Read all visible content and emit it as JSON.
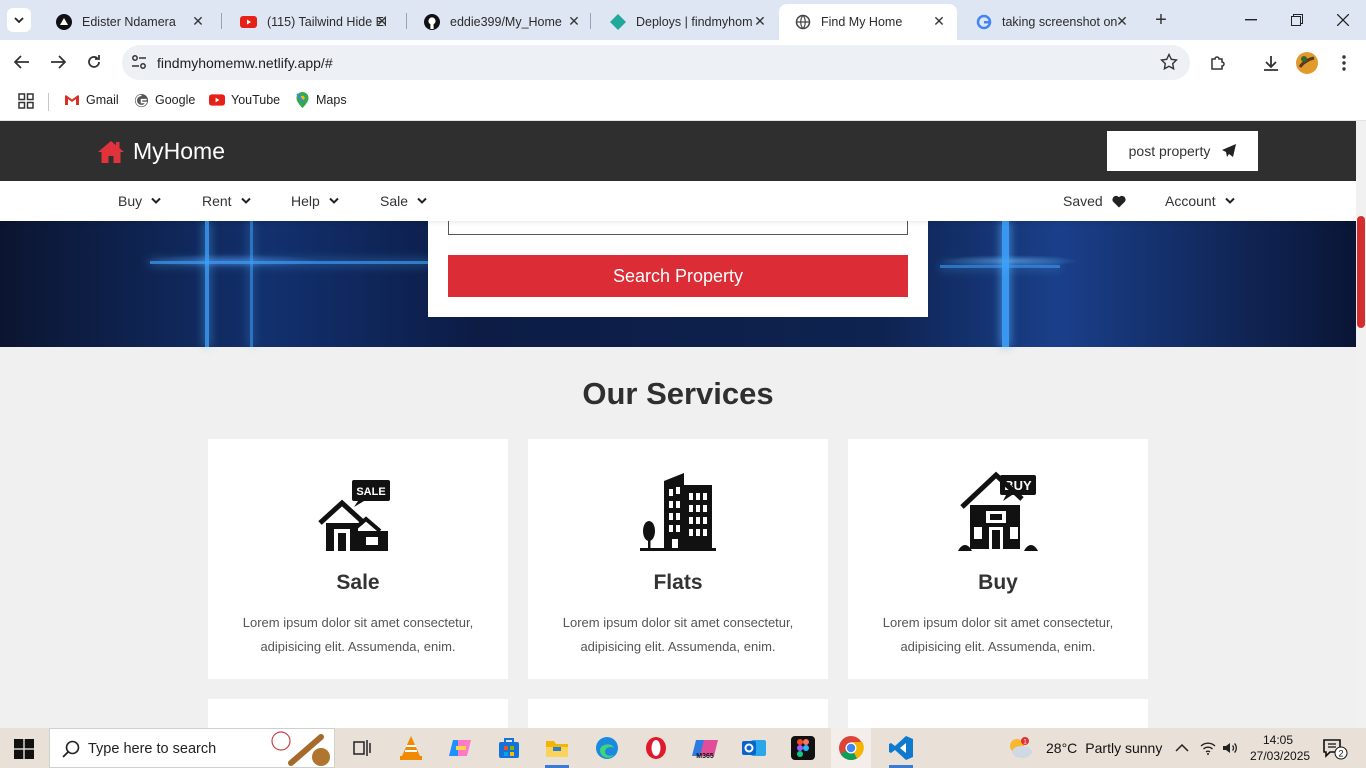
{
  "browser": {
    "tabs": [
      {
        "title": "Edister Ndamera",
        "icon": "netlify-triangle-icon",
        "active": false
      },
      {
        "title": "(115) Tailwind Hide El",
        "icon": "youtube-icon",
        "active": false
      },
      {
        "title": "eddie399/My_Home",
        "icon": "github-icon",
        "active": false
      },
      {
        "title": "Deploys | findmyhom",
        "icon": "netlify-diamond-icon",
        "active": false
      },
      {
        "title": "Find My Home",
        "icon": "globe-icon",
        "active": true
      },
      {
        "title": "taking screenshot on",
        "icon": "google-icon",
        "active": false
      }
    ],
    "url": "findmyhomemw.netlify.app/#",
    "bookmarks": [
      {
        "label": "Gmail",
        "icon": "gmail-icon"
      },
      {
        "label": "Google",
        "icon": "google-icon"
      },
      {
        "label": "YouTube",
        "icon": "youtube-icon"
      },
      {
        "label": "Maps",
        "icon": "maps-icon"
      }
    ]
  },
  "site": {
    "logo": "MyHome",
    "post_button": "post property",
    "nav": {
      "left": [
        "Buy",
        "Rent",
        "Help",
        "Sale"
      ],
      "saved": "Saved",
      "account": "Account"
    },
    "search_button": "Search Property",
    "section_title": "Our Services",
    "services": [
      {
        "title": "Sale",
        "text": "Lorem ipsum dolor sit amet consectetur, adipisicing elit. Assumenda, enim.",
        "icon": "sale-house-icon",
        "badge": "SALE"
      },
      {
        "title": "Flats",
        "text": "Lorem ipsum dolor sit amet consectetur, adipisicing elit. Assumenda, enim.",
        "icon": "flats-building-icon"
      },
      {
        "title": "Buy",
        "text": "Lorem ipsum dolor sit amet consectetur, adipisicing elit. Assumenda, enim.",
        "icon": "buy-house-icon",
        "badge": "BUY"
      }
    ],
    "colors": {
      "brand_red": "#dc2c35",
      "header_dark": "#2f2f2f"
    }
  },
  "taskbar": {
    "search_placeholder": "Type here to search",
    "weather": {
      "temp": "28°C",
      "condition": "Partly sunny",
      "alert_count": "1"
    },
    "time": "14:05",
    "date": "27/03/2025",
    "notifications": "2"
  }
}
